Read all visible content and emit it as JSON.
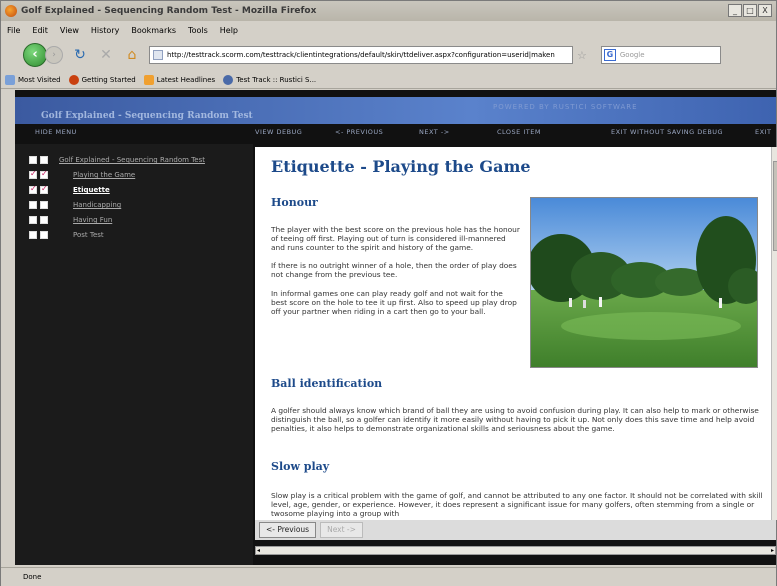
{
  "browser": {
    "window_title": "Golf Explained - Sequencing Random Test - Mozilla Firefox",
    "window_buttons": [
      "_",
      "□",
      "X"
    ],
    "menu": [
      "File",
      "Edit",
      "View",
      "History",
      "Bookmarks",
      "Tools",
      "Help"
    ],
    "url": "http://testtrack.scorm.com/testtrack/clientintegrations/default/skin/ttdeliver.aspx?configuration=userid|maken",
    "search_placeholder": "Google",
    "bookmarks": [
      "Most Visited",
      "Getting Started",
      "Latest Headlines",
      "Test Track :: Rustici S..."
    ],
    "status": "Done"
  },
  "player": {
    "course_title": "Golf Explained - Sequencing Random Test",
    "powered_by": "POWERED BY RUSTICI SOFTWARE",
    "toolbar": {
      "hide_menu": "HIDE MENU",
      "view_debug": "VIEW DEBUG",
      "previous": "<- PREVIOUS",
      "next": "NEXT ->",
      "close_item": "CLOSE ITEM",
      "exit_without_saving": "EXIT WITHOUT SAVING DEBUG",
      "exit": "EXIT"
    },
    "toc": {
      "root": "Golf Explained - Sequencing Random Test",
      "items": [
        {
          "label": "Playing the Game",
          "checked": true
        },
        {
          "label": "Etiquette",
          "checked": true,
          "current": true
        },
        {
          "label": "Handicapping",
          "checked": false
        },
        {
          "label": "Having Fun",
          "checked": false
        },
        {
          "label": "Post Test",
          "checked": false
        }
      ]
    },
    "bottom": {
      "prev": "<- Previous",
      "next": "Next ->"
    }
  },
  "page": {
    "title": "Etiquette - Playing the Game",
    "sections": [
      {
        "heading": "Honour",
        "paragraphs": [
          "The player with the best score on the previous hole has the honour of teeing off first. Playing out of turn is considered ill-mannered and runs counter to the spirit and history of the game.",
          "If there is no outright winner of a hole, then the order of play does not change from the previous tee.",
          "In informal games one can play ready golf and not wait for the best score on the hole to tee it up first. Also to speed up play drop off your partner when riding in a cart then go to your ball."
        ]
      },
      {
        "heading": "Ball identification",
        "paragraphs": [
          "A golfer should always know which brand of ball they are using to avoid confusion during play. It can also help to mark or otherwise distinguish the ball, so a golfer can identify it more easily without having to pick it up. Not only does this save time and help avoid penalties, it also helps to demonstrate organizational skills and seriousness about the game."
        ]
      },
      {
        "heading": "Slow play",
        "paragraphs": [
          "Slow play is a critical problem with the game of golf, and cannot be attributed to any one factor. It should not be correlated with skill level, age, gender, or experience. However, it does represent a significant issue for many golfers, often stemming from a single or twosome playing into a group with"
        ]
      }
    ]
  }
}
